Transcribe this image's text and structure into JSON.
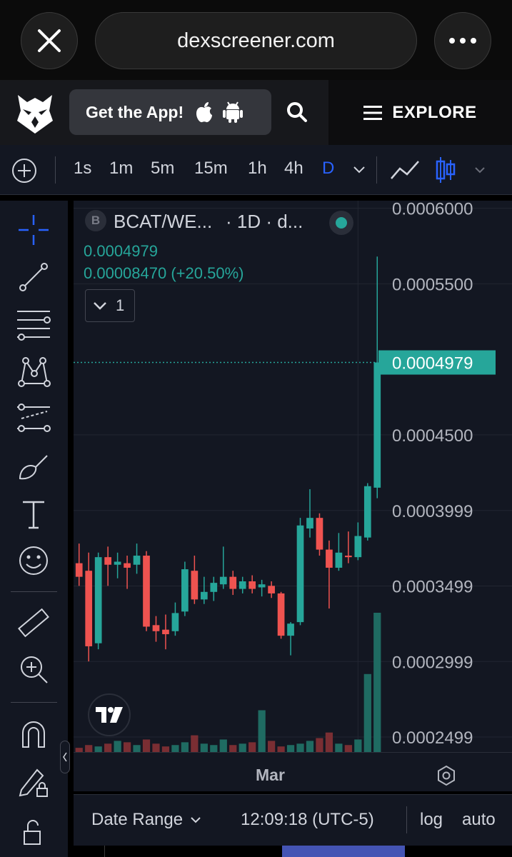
{
  "browser": {
    "url": "dexscreener.com"
  },
  "header": {
    "get_app_label": "Get the App!",
    "explore_label": "EXPLORE"
  },
  "timeframes": [
    "1s",
    "1m",
    "5m",
    "15m",
    "1h",
    "4h",
    "D"
  ],
  "legend": {
    "badge": "B",
    "symbol": "BCAT/WE...",
    "interval": "· 1D · d...",
    "price": "0.0004979",
    "change": "0.00008470 (+20.50%)",
    "collapse_count": "1"
  },
  "bottom": {
    "x_label": "Mar",
    "date_range_label": "Date Range",
    "clock": "12:09:18 (UTC-5)",
    "log_label": "log",
    "auto_label": "auto"
  },
  "colors": {
    "up": "#26a69a",
    "down": "#ef5350",
    "accent": "#2962ff",
    "bg": "#131722"
  },
  "chart_data": {
    "type": "candlestick",
    "y_ticks": [
      "0.0006000",
      "0.0005500",
      "0.0004500",
      "0.0003999",
      "0.0003499",
      "0.0002999",
      "0.0002499"
    ],
    "last_price_label": "0.0004979",
    "x_tick_labels": [
      "Mar"
    ],
    "ylim": [
      0.00024,
      0.000605
    ],
    "candles": [
      {
        "o": 0.000365,
        "h": 0.000378,
        "l": 0.00035,
        "c": 0.000356
      },
      {
        "o": 0.00036,
        "h": 0.000372,
        "l": 0.0003,
        "c": 0.00031
      },
      {
        "o": 0.000312,
        "h": 0.000372,
        "l": 0.000308,
        "c": 0.000369
      },
      {
        "o": 0.000369,
        "h": 0.000376,
        "l": 0.00035,
        "c": 0.000364
      },
      {
        "o": 0.000364,
        "h": 0.000372,
        "l": 0.000355,
        "c": 0.000366
      },
      {
        "o": 0.000365,
        "h": 0.00037,
        "l": 0.000348,
        "c": 0.000362
      },
      {
        "o": 0.000364,
        "h": 0.000378,
        "l": 0.000358,
        "c": 0.00037
      },
      {
        "o": 0.00037,
        "h": 0.000373,
        "l": 0.00032,
        "c": 0.000323
      },
      {
        "o": 0.000324,
        "h": 0.00033,
        "l": 0.000313,
        "c": 0.00032
      },
      {
        "o": 0.000321,
        "h": 0.000331,
        "l": 0.000308,
        "c": 0.000318
      },
      {
        "o": 0.00032,
        "h": 0.000339,
        "l": 0.000317,
        "c": 0.000332
      },
      {
        "o": 0.000333,
        "h": 0.000366,
        "l": 0.00033,
        "c": 0.000361
      },
      {
        "o": 0.00036,
        "h": 0.00037,
        "l": 0.000338,
        "c": 0.000341
      },
      {
        "o": 0.000341,
        "h": 0.000356,
        "l": 0.000338,
        "c": 0.000346
      },
      {
        "o": 0.000346,
        "h": 0.000356,
        "l": 0.00034,
        "c": 0.000352
      },
      {
        "o": 0.000351,
        "h": 0.000376,
        "l": 0.000348,
        "c": 0.000356
      },
      {
        "o": 0.000356,
        "h": 0.00036,
        "l": 0.000344,
        "c": 0.000348
      },
      {
        "o": 0.000348,
        "h": 0.000356,
        "l": 0.000345,
        "c": 0.000353
      },
      {
        "o": 0.000353,
        "h": 0.000357,
        "l": 0.000345,
        "c": 0.000348
      },
      {
        "o": 0.000349,
        "h": 0.000354,
        "l": 0.000343,
        "c": 0.000351
      },
      {
        "o": 0.00035,
        "h": 0.000353,
        "l": 0.000342,
        "c": 0.000345
      },
      {
        "o": 0.000345,
        "h": 0.000346,
        "l": 0.000315,
        "c": 0.000317
      },
      {
        "o": 0.000317,
        "h": 0.000326,
        "l": 0.000304,
        "c": 0.000325
      },
      {
        "o": 0.000326,
        "h": 0.000395,
        "l": 0.000324,
        "c": 0.00039
      },
      {
        "o": 0.000388,
        "h": 0.000414,
        "l": 0.000382,
        "c": 0.000395
      },
      {
        "o": 0.000395,
        "h": 0.000398,
        "l": 0.00037,
        "c": 0.000374
      },
      {
        "o": 0.000374,
        "h": 0.00038,
        "l": 0.000335,
        "c": 0.000362
      },
      {
        "o": 0.000362,
        "h": 0.000385,
        "l": 0.00036,
        "c": 0.000372
      },
      {
        "o": 0.00037,
        "h": 0.000386,
        "l": 0.000365,
        "c": 0.000369
      },
      {
        "o": 0.000369,
        "h": 0.000392,
        "l": 0.000367,
        "c": 0.000383
      },
      {
        "o": 0.000382,
        "h": 0.000418,
        "l": 0.00038,
        "c": 0.000416
      },
      {
        "o": 0.000415,
        "h": 0.000568,
        "l": 0.000408,
        "c": 0.0004979
      }
    ],
    "volume": [
      3,
      5,
      4,
      6,
      8,
      7,
      5,
      9,
      6,
      4,
      5,
      7,
      12,
      6,
      5,
      9,
      5,
      6,
      7,
      30,
      8,
      4,
      5,
      6,
      8,
      10,
      14,
      6,
      5,
      9,
      56,
      100
    ]
  }
}
